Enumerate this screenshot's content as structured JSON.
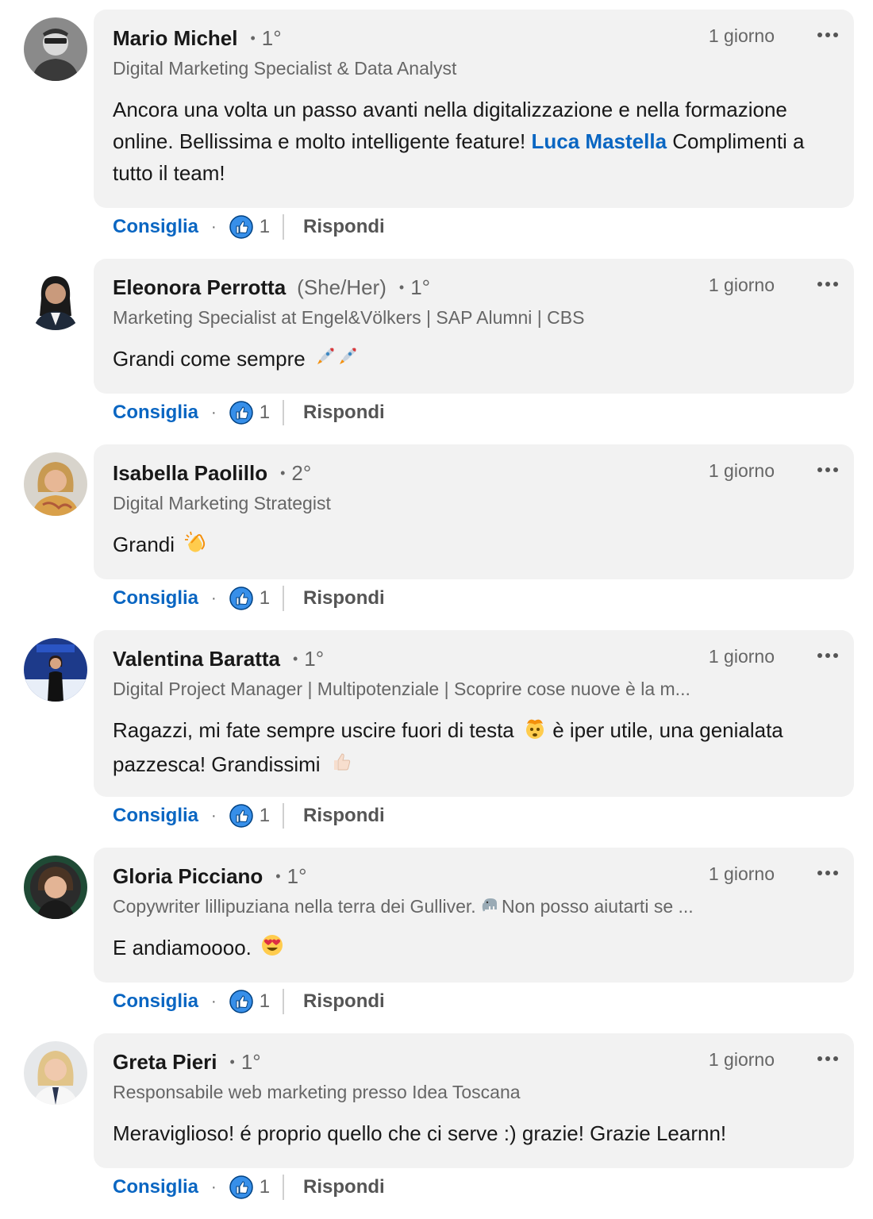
{
  "ui": {
    "like_label": "Consiglia",
    "reply_label": "Rispondi",
    "reaction_count": "1",
    "dot": "·"
  },
  "comments": [
    {
      "name": "Mario Michel",
      "pronouns": "",
      "degree": "1°",
      "time": "1 giorno",
      "headline": "Digital Marketing Specialist & Data Analyst",
      "text_before": "Ancora una volta un passo avanti nella digitalizzazione e nella formazione online. Bellissima e molto intelligente feature! ",
      "mention": "Luca Mastella",
      "text_after": " Complimenti a tutto il team!"
    },
    {
      "name": "Eleonora Perrotta",
      "pronouns": "(She/Her)",
      "degree": "1°",
      "time": "1 giorno",
      "headline": "Marketing Specialist at Engel&Völkers | SAP Alumni | CBS",
      "text": "Grandi come sempre"
    },
    {
      "name": "Isabella Paolillo",
      "pronouns": "",
      "degree": "2°",
      "time": "1 giorno",
      "headline": "Digital Marketing Strategist",
      "text": "Grandi"
    },
    {
      "name": "Valentina Baratta",
      "pronouns": "",
      "degree": "1°",
      "time": "1 giorno",
      "headline": "Digital Project Manager | Multipotenziale | Scoprire cose nuove è la m...",
      "text_before": "Ragazzi, mi fate sempre uscire fuori di testa",
      "text_mid": " è iper utile, una genialata pazzesca! Grandissimi"
    },
    {
      "name": "Gloria Picciano",
      "pronouns": "",
      "degree": "1°",
      "time": "1 giorno",
      "headline_before": "Copywriter lillipuziana nella terra dei Gulliver. ",
      "headline_after": "Non posso aiutarti se ...",
      "text": "E andiamoooo."
    },
    {
      "name": "Greta Pieri",
      "pronouns": "",
      "degree": "1°",
      "time": "1 giorno",
      "headline": "Responsabile web marketing presso Idea Toscana",
      "text": "Meraviglioso! é proprio quello che ci serve :) grazie! Grazie Learnn!"
    }
  ],
  "colors": {
    "link_blue": "#0a66c2",
    "bubble_bg": "#f2f2f2",
    "muted": "#666666"
  }
}
